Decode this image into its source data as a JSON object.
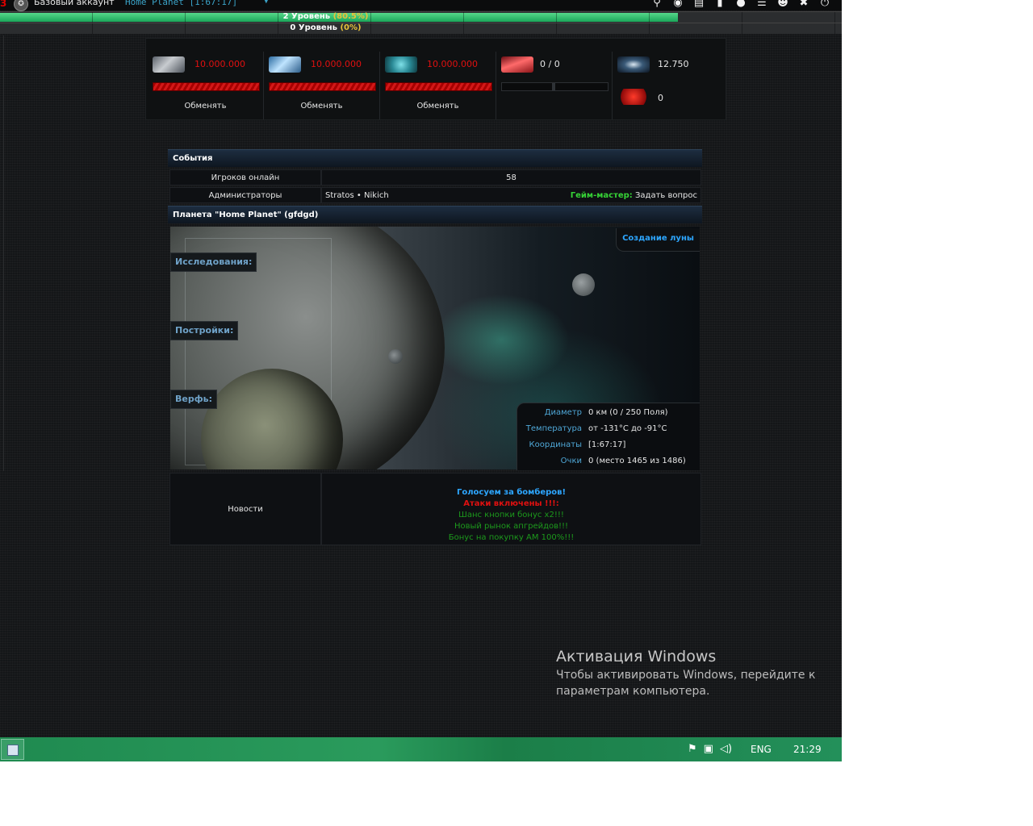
{
  "topbar": {
    "account_label": "Базовый аккаунт",
    "planet_selector": "Home Planet   [1:67:17]",
    "icons": [
      "search-icon",
      "compass-icon",
      "research-icon",
      "bookmark-icon",
      "chat-icon",
      "notes-icon",
      "friends-icon",
      "tools-icon",
      "power-icon"
    ]
  },
  "levels": {
    "bar1_level": "2 Уровень",
    "bar1_pct": "(80.5%)",
    "bar1_progress": 0.805,
    "bar2_level": "0 Уровень",
    "bar2_pct": "(0%)",
    "bar2_progress": 0
  },
  "resources": {
    "metal": {
      "amount": "10.000.000",
      "trade": "Обменять"
    },
    "crystal": {
      "amount": "10.000.000",
      "trade": "Обменять"
    },
    "deuterium": {
      "amount": "10.000.000",
      "trade": "Обменять"
    },
    "energy": {
      "amount": "0 / 0"
    },
    "dark_matter": {
      "amount": "12.750"
    },
    "red_matter": {
      "amount": "0"
    }
  },
  "events": {
    "header": "События",
    "online_label": "Игроков онлайн",
    "online_value": "58",
    "admins_label": "Администраторы",
    "admins_value": "Stratos • Nikich",
    "gm_label": "Гейм-мастер:",
    "gm_link": "Задать вопрос"
  },
  "planet": {
    "header": "Планета \"Home Planet\" (gfdgd)",
    "research_label": "Исследования:",
    "buildings_label": "Постройки:",
    "shipyard_label": "Верфь:",
    "moon_button": "Создание луны",
    "info": [
      {
        "key": "Диаметр",
        "value": "0 км (0 / 250 Поля)"
      },
      {
        "key": "Температура",
        "value": "от -131°C до -91°C"
      },
      {
        "key": "Координаты",
        "value": "[1:67:17]"
      },
      {
        "key": "Очки",
        "value": "0 (место 1465 из 1486)"
      }
    ]
  },
  "news": {
    "label": "Новости",
    "items": [
      "Голосуем за бомберов!",
      "Атаки включены !!!:",
      "Шанс кнопки бонус х2!!!",
      "Новый рынок апгрейдов!!!",
      "Бонус на покупку АМ 100%!!!"
    ]
  },
  "windows": {
    "activation_title": "Активация Windows",
    "activation_line1": "Чтобы активировать Windows, перейдите к",
    "activation_line2": "параметрам компьютера.",
    "lang": "ENG",
    "clock": "21:29"
  },
  "colors": {
    "accent_blue": "#2da6ff",
    "resource_red": "#e01010",
    "progress_green": "#2bbf6a",
    "gm_green": "#36d336",
    "taskbar_green": "#1f8a50"
  }
}
